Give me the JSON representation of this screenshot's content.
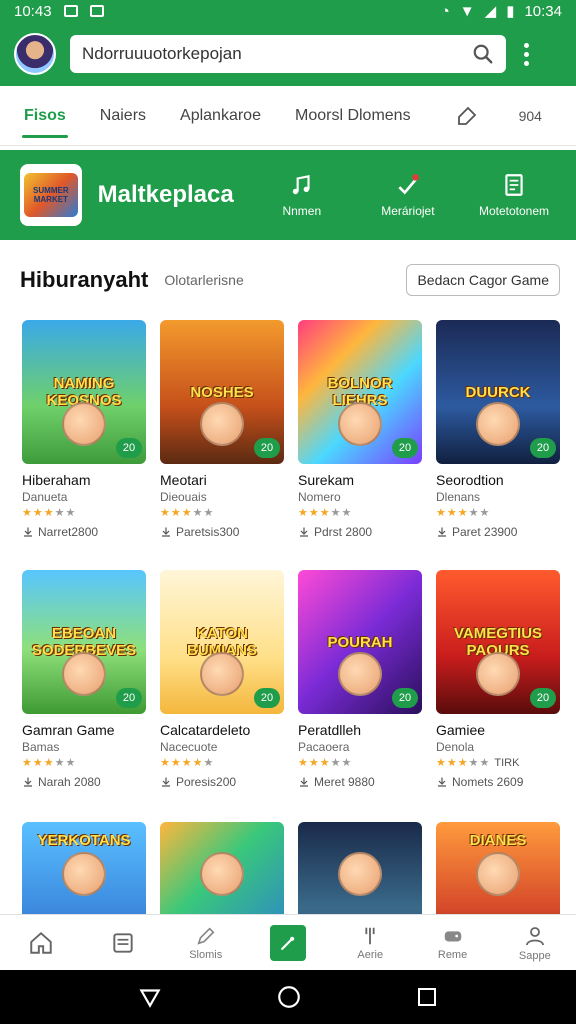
{
  "status_bar": {
    "time_left": "10:43",
    "time_right": "10:34"
  },
  "search": {
    "value": "Ndorruuuotorkepojan"
  },
  "tabs": [
    {
      "label": "Fisos",
      "active": true
    },
    {
      "label": "Naiers",
      "active": false
    },
    {
      "label": "Aplankaroe",
      "active": false
    },
    {
      "label": "Moorsl Dlomens",
      "active": false
    }
  ],
  "tab_count": "904",
  "banner": {
    "logo_text": "SUMMER MARKET",
    "title": "Maltkeplaca",
    "nav": [
      {
        "icon": "music-icon",
        "label": "Nnmen"
      },
      {
        "icon": "edit-check-icon",
        "label": "Meráriojet"
      },
      {
        "icon": "document-icon",
        "label": "Motetotonem"
      }
    ]
  },
  "section": {
    "title": "Hiburanyaht",
    "subtitle": "Olotarlerisne",
    "button": "Bedacn Cagor Game"
  },
  "games": [
    {
      "thumb_text": "NAMING KEOSNOS",
      "title": "Hiberaham",
      "developer": "Danueta",
      "stars": 3,
      "meta": "Narret2800",
      "badge": "20",
      "bg": "linear-gradient(180deg,#3aa9e8 0%,#6fd06a 60%,#3e9b3a 100%)"
    },
    {
      "thumb_text": "NOSHES",
      "title": "Meotari",
      "developer": "Dieouais",
      "stars": 3,
      "meta": "Paretsis300",
      "badge": "20",
      "bg": "linear-gradient(180deg,#f39a2d 0%,#c6501b 60%,#5b2a12 100%)"
    },
    {
      "thumb_text": "BOLNOR LIEHRS",
      "title": "Surekam",
      "developer": "Nomero",
      "stars": 3,
      "meta": "Pdrst 2800",
      "badge": "20",
      "bg": "linear-gradient(135deg,#ff3d7f 0%,#ffb63d 30%,#4bd8ff 60%,#7a3dff 100%)"
    },
    {
      "thumb_text": "DUURCK",
      "title": "Seorodtion",
      "developer": "Dlenans",
      "stars": 3,
      "meta": "Paret 23900",
      "badge": "20",
      "bg": "linear-gradient(180deg,#1b2a55 0%,#2d5aa0 60%,#11203f 100%)"
    },
    {
      "thumb_text": "EBEOAN SODERBEVES",
      "title": "Gamran Game",
      "developer": "Bamas",
      "stars": 3,
      "meta": "Narah 2080",
      "badge": "20",
      "bg": "linear-gradient(180deg,#58c6ff 0%,#8ee07a 55%,#3f9a34 100%)"
    },
    {
      "thumb_text": "KATON BUMIANS",
      "title": "Calcatardeleto",
      "developer": "Nacecuote",
      "stars": 4,
      "meta": "Poresis200",
      "badge": "20",
      "bg": "linear-gradient(180deg,#fff6d8 0%,#ffe08a 60%,#f4b73c 100%)"
    },
    {
      "thumb_text": "POURAH",
      "title": "Peratdlleh",
      "developer": "Pacaoera",
      "stars": 3,
      "meta": "Meret 9880",
      "badge": "20",
      "bg": "linear-gradient(135deg,#ff4ad6 0%,#7a2bd6 50%,#2a0f5a 100%)"
    },
    {
      "thumb_text": "VAMEGTIUS PAOURS",
      "title": "Gamiee",
      "developer": "Denola",
      "stars": 3,
      "meta": "Nomets 2609",
      "badge": "20",
      "extra": "TIRK",
      "bg": "linear-gradient(180deg,#ff5b2e 0%,#c91d1d 60%,#5a0c0c 100%)"
    }
  ],
  "partial_games": [
    {
      "thumb_text": "YERKOTANS",
      "bg": "linear-gradient(180deg,#5ac0ff 0%,#3d8be0 60%,#2a5aa0 100%)"
    },
    {
      "thumb_text": "",
      "bg": "linear-gradient(135deg,#ffb63d 0%,#3ac87a 40%,#2a7ad6 100%)"
    },
    {
      "thumb_text": "",
      "bg": "linear-gradient(180deg,#1a2a4a 0%,#3a6a8a 60%,#2a3a5a 100%)"
    },
    {
      "thumb_text": "DIANES",
      "bg": "linear-gradient(180deg,#ff9a3d 0%,#d64a2a 60%,#5a1a10 100%)"
    }
  ],
  "bottom_nav": [
    {
      "icon": "home-icon",
      "label": ""
    },
    {
      "icon": "list-icon",
      "label": ""
    },
    {
      "icon": "pen-icon",
      "label": "Slomis"
    },
    {
      "icon": "active-brush-icon",
      "label": ""
    },
    {
      "icon": "tools-icon",
      "label": "Aerie"
    },
    {
      "icon": "game-icon",
      "label": "Reme"
    },
    {
      "icon": "profile-icon",
      "label": "Sappe"
    }
  ],
  "colors": {
    "primary": "#1f9d4a",
    "star": "#f5a623"
  }
}
